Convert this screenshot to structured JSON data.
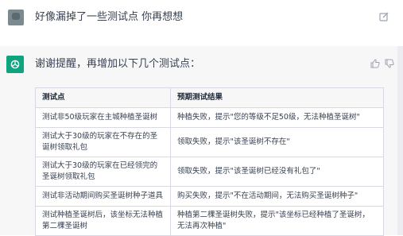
{
  "user_message": "好像漏掉了一些测试点  你再想想",
  "assistant_message": "谢谢提醒，再增加以下几个测试点：",
  "table": {
    "headers": [
      "测试点",
      "预期测试结果"
    ],
    "rows": [
      [
        "测试非50级玩家在主城种植圣诞树",
        "种植失败，提示\"您的等级不足50级，无法种植圣诞树\""
      ],
      [
        "测试大于30级的玩家在不存在的圣诞树领取礼包",
        "领取失败，提示\"该圣诞树不存在\""
      ],
      [
        "测试大于30级的玩家在已经领完的圣诞树领取礼包",
        "领取失败，提示\"该圣诞树已经没有礼包了\""
      ],
      [
        "测试非活动期间购买圣诞树种子道具",
        "购买失败，提示\"不在活动期间，无法购买圣诞树种子\""
      ],
      [
        "测试种植圣诞树后，该坐标无法种植第二棵圣诞树",
        "种植第二棵圣诞树失败，提示\"该坐标已经种植了圣诞树，无法再次种植\""
      ]
    ]
  },
  "colors": {
    "assistant_avatar": "#10a37f",
    "assistant_bg": "#f7f7f8",
    "border": "#d9d9e3"
  },
  "icons": [
    "edit-icon",
    "thumbs-up-icon",
    "thumbs-down-icon",
    "openai-logo-icon"
  ]
}
